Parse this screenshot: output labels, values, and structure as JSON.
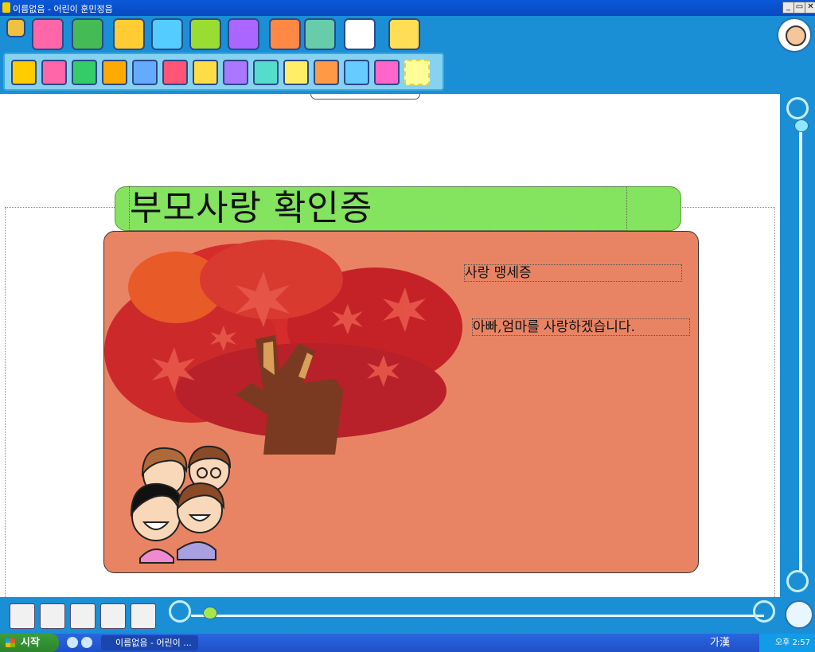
{
  "window": {
    "title": "이름없음 - 어린이 훈민정음",
    "controls": [
      "_",
      "▭",
      "✕"
    ]
  },
  "toolbar_row1": {
    "icons": [
      "eye-icon",
      "box-icon",
      "picture-icon",
      "cube-icon",
      "grid-icon",
      "paint-icon",
      "star-icon",
      "photo-icon",
      "book-icon",
      "eyes-icon",
      "bird-icon"
    ],
    "colors": [
      "#f0c040",
      "#ff66aa",
      "#44bb55",
      "#ffcc33",
      "#55ccff",
      "#99dd33",
      "#aa66ff",
      "#ff8844",
      "#66ccaa",
      "#ffffff",
      "#ffdd55"
    ]
  },
  "toolbar_row2": {
    "icons": [
      "text-icon",
      "font-size-icon",
      "text-style-icon",
      "plus-minus-icon",
      "align-icon",
      "color-text-icon",
      "textbox-icon",
      "pen-icon",
      "char-icon",
      "label-icon",
      "hangul-icon",
      "layer-icon",
      "shape-icon",
      "select-icon"
    ],
    "colors": [
      "#ffcc00",
      "#ff66aa",
      "#33cc66",
      "#ffaa00",
      "#66aaff",
      "#ff5577",
      "#ffdd44",
      "#aa77ff",
      "#55ddcc",
      "#ffee66",
      "#ff9944",
      "#66ccff",
      "#ff66cc",
      "#ffff99"
    ]
  },
  "document": {
    "title": "부모사랑 확인증",
    "line1": "사랑 맹세증",
    "line2": "아빠,엄마를 사랑하겠습니다."
  },
  "colors": {
    "title_bg": "#84e35f",
    "card_bg": "#e88464",
    "tree_dark": "#b8202a",
    "tree_mid": "#d62c2c",
    "trunk": "#7a3a22"
  },
  "page_buttons": [
    "page-prev-icon",
    "page-add-icon",
    "page-view-icon",
    "page-next-icon",
    "page-copy-icon"
  ],
  "taskbar": {
    "start_label": "시작",
    "task_title": "이름없음 - 어린이 ...",
    "ime": "가漢",
    "clock": "오후 2:57"
  }
}
